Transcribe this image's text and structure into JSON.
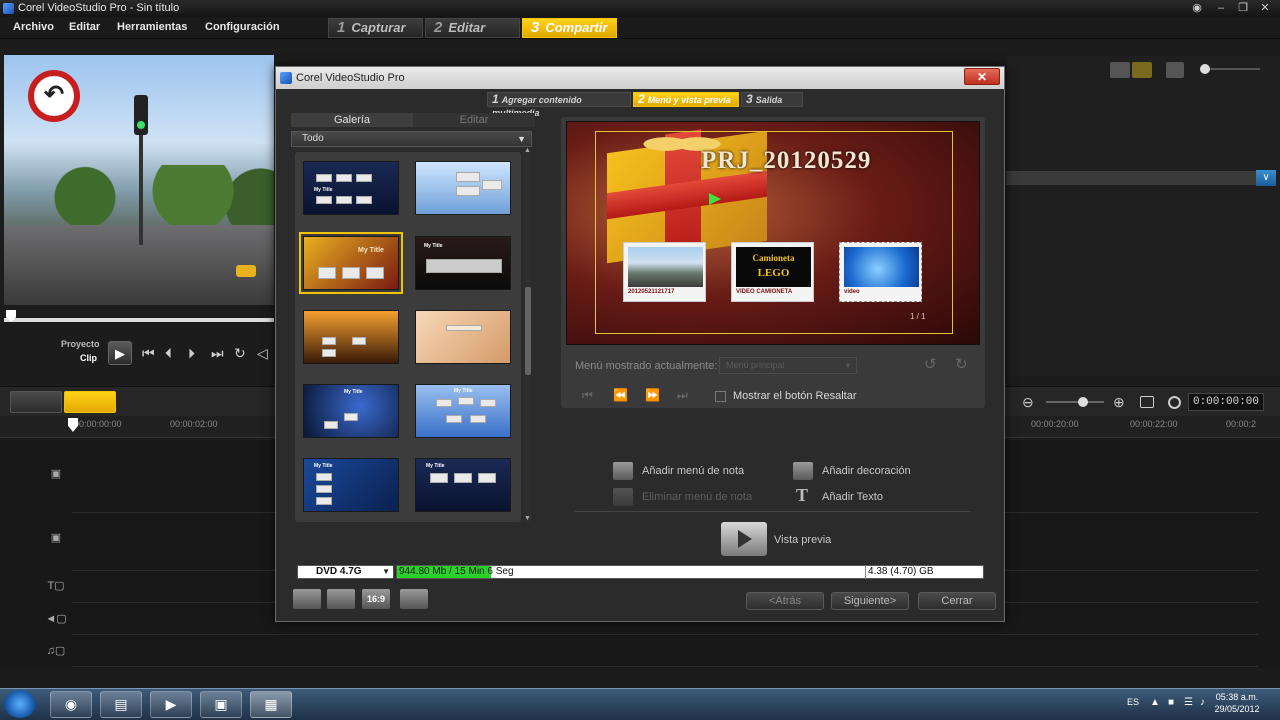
{
  "window": {
    "title": "Corel VideoStudio Pro - Sin título",
    "controls": [
      "‒",
      "❐",
      "✕"
    ]
  },
  "menu": {
    "items": [
      "Archivo",
      "Editar",
      "Herramientas",
      "Configuración"
    ],
    "steps": [
      {
        "num": "1",
        "label": "Capturar"
      },
      {
        "num": "2",
        "label": "Editar"
      },
      {
        "num": "3",
        "label": "Compartir"
      }
    ],
    "active_step": "3"
  },
  "player": {
    "proyecto_label": "Proyecto",
    "clip_label": "Clip",
    "controls": [
      "play-icon",
      "skip-start-icon",
      "step-back-icon",
      "step-forward-icon",
      "skip-end-icon",
      "repeat-icon",
      "volume-icon"
    ],
    "glyphs": {
      "play": "▶",
      "start": "⏮",
      "back": "⏴",
      "fwd": "⏵",
      "end": "⏭",
      "repeat": "↻",
      "volume": "◁"
    },
    "sign_glyph": "↶"
  },
  "timeline": {
    "timecode": "0:00:00:00",
    "ruler_labels": [
      "00:00:00:00",
      "00:00:02:00",
      "00:00:20:00",
      "00:00:22:00",
      "00:00:2"
    ],
    "track_icons": [
      "video-track-icon",
      "overlay-track-icon",
      "title-track-icon",
      "voice-track-icon",
      "music-track-icon"
    ],
    "track_glyphs": [
      "▣",
      "▣",
      "T▢",
      "◄▢",
      "♫▢"
    ],
    "zoom_out": "⊖",
    "zoom_in": "⊕"
  },
  "dialog": {
    "title": "Corel VideoStudio Pro",
    "close": "✕",
    "wizard_steps": [
      {
        "num": "1",
        "label": "Agregar contenido multimedia"
      },
      {
        "num": "2",
        "label": "Menú y vista previa"
      },
      {
        "num": "3",
        "label": "Salida"
      }
    ],
    "active_wizard_step": "2",
    "gallery": {
      "tabs": [
        "Galería",
        "Editar"
      ],
      "active_tab": "Galería",
      "category": "Todo",
      "thumbnails": [
        {
          "name": "template-1",
          "title": "My Title"
        },
        {
          "name": "template-2",
          "title": ""
        },
        {
          "name": "template-3",
          "title": "My Title",
          "selected": true
        },
        {
          "name": "template-4",
          "title": "My Title"
        },
        {
          "name": "template-5",
          "title": ""
        },
        {
          "name": "template-6",
          "title": ""
        },
        {
          "name": "template-7",
          "title": "My Title"
        },
        {
          "name": "template-8",
          "title": "My Title"
        },
        {
          "name": "template-9",
          "title": "My Title"
        },
        {
          "name": "template-10",
          "title": "My Title"
        }
      ]
    },
    "menu_preview": {
      "title": "PRJ_20120529",
      "items": [
        {
          "caption": "20120521121717"
        },
        {
          "caption": "VIDEO CAMIONETA",
          "line1": "Camioneta",
          "line2": "LEGO"
        },
        {
          "caption": "video"
        }
      ],
      "page": "1 / 1"
    },
    "shown_label": "Menú mostrado actualmente:",
    "shown_value": "Menú principal",
    "highlight_label": "Mostrar el botón Resaltar",
    "actions": {
      "add_note_menu": "Añadir menú de nota",
      "remove_note_menu": "Eliminar menú de nota",
      "add_decoration": "Añadir decoración",
      "add_text": "Añadir Texto",
      "preview": "Vista previa"
    },
    "disc": {
      "type": "DVD 4.7G",
      "usage": "944.80 Mb / 15 Min 6 Seg",
      "capacity": "4.38 (4.70) GB",
      "fill_fraction": 0.16
    },
    "buttons": {
      "back": "<Atrás",
      "next": "Siguiente>",
      "close": "Cerrar"
    },
    "aspect_label": "16:9"
  },
  "taskbar": {
    "apps": [
      "chrome-icon",
      "folder-icon",
      "media-icon",
      "camera-icon",
      "videostudio-icon"
    ],
    "app_glyphs": [
      "◉",
      "▤",
      "▶",
      "▣",
      "▦"
    ],
    "lang": "ES",
    "time": "05:38 a.m.",
    "date": "29/05/2012",
    "tray_glyphs": [
      "▲",
      "■",
      "☰",
      "♪"
    ]
  }
}
